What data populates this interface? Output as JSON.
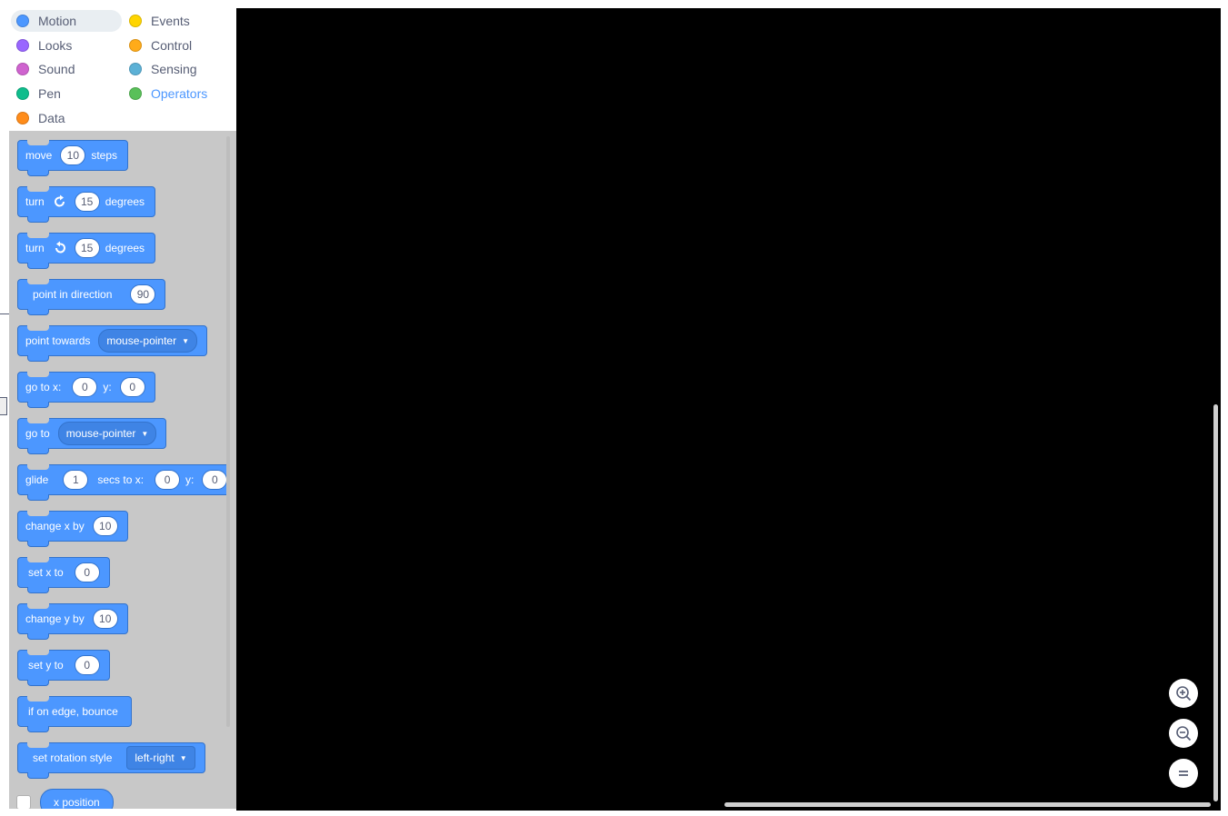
{
  "categories": [
    {
      "label": "Motion",
      "color": "#4c97ff"
    },
    {
      "label": "Looks",
      "color": "#9966ff"
    },
    {
      "label": "Sound",
      "color": "#cf63cf"
    },
    {
      "label": "Pen",
      "color": "#0fbd8c"
    },
    {
      "label": "Data",
      "color": "#ff8c1a"
    },
    {
      "label": "Events",
      "color": "#ffd500"
    },
    {
      "label": "Control",
      "color": "#ffab19"
    },
    {
      "label": "Sensing",
      "color": "#5cb1d6"
    },
    {
      "label": "Operators",
      "color": "#59c059"
    }
  ],
  "blocks": {
    "move": {
      "pre": "move",
      "value": "10",
      "post": "steps"
    },
    "turn_right": {
      "pre": "turn",
      "value": "15",
      "post": "degrees"
    },
    "turn_left": {
      "pre": "turn",
      "value": "15",
      "post": "degrees"
    },
    "point_direction": {
      "pre": "point in direction",
      "value": "90"
    },
    "point_towards": {
      "pre": "point towards",
      "option": "mouse-pointer"
    },
    "go_to_xy": {
      "pre": "go to x:",
      "x": "0",
      "mid": "y:",
      "y": "0"
    },
    "go_to": {
      "pre": "go to",
      "option": "mouse-pointer"
    },
    "glide": {
      "pre": "glide",
      "secs": "1",
      "mid": "secs to x:",
      "x": "0",
      "mid2": "y:",
      "y": "0"
    },
    "change_x": {
      "pre": "change x by",
      "value": "10"
    },
    "set_x": {
      "pre": "set x to",
      "value": "0"
    },
    "change_y": {
      "pre": "change y by",
      "value": "10"
    },
    "set_y": {
      "pre": "set y to",
      "value": "0"
    },
    "bounce": {
      "pre": "if on edge, bounce"
    },
    "rotation_style": {
      "pre": "set rotation style",
      "option": "left-right"
    },
    "x_position": {
      "label": "x position"
    }
  },
  "icons": {
    "turn_right": "rotate-clockwise-icon",
    "turn_left": "rotate-counterclockwise-icon",
    "dropdown": "caret-down-icon",
    "zoom_in": "zoom-in-icon",
    "zoom_out": "zoom-out-icon",
    "zoom_reset": "zoom-reset-icon"
  }
}
